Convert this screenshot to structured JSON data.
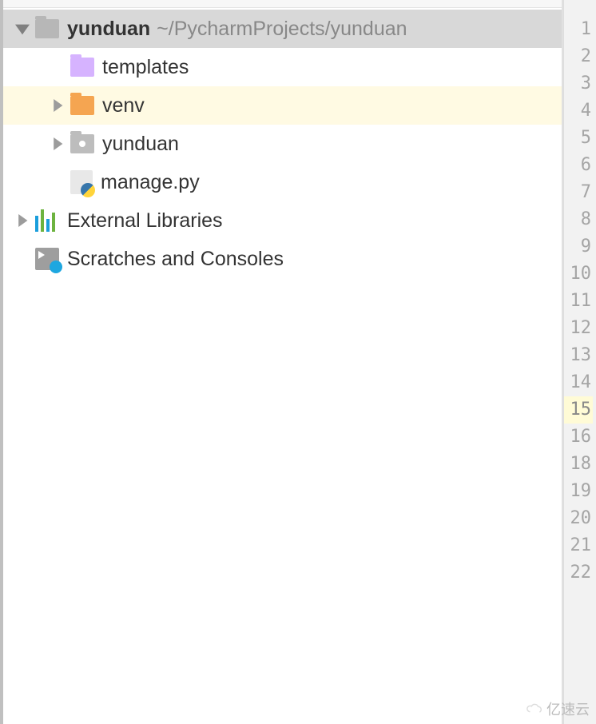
{
  "project": {
    "name": "yunduan",
    "path": "~/PycharmProjects/yunduan",
    "children": [
      {
        "label": "templates",
        "icon": "folder-purple",
        "expandable": false
      },
      {
        "label": "venv",
        "icon": "folder-orange",
        "expandable": true,
        "highlighted": true
      },
      {
        "label": "yunduan",
        "icon": "folder-dot",
        "expandable": true
      },
      {
        "label": "manage.py",
        "icon": "python-file",
        "expandable": false
      }
    ]
  },
  "external_libraries_label": "External Libraries",
  "scratches_label": "Scratches and Consoles",
  "gutter": {
    "lines": [
      1,
      2,
      3,
      4,
      5,
      6,
      7,
      8,
      9,
      10,
      11,
      12,
      13,
      14,
      15,
      16,
      18,
      19,
      20,
      21,
      22
    ],
    "current_line": 15
  },
  "watermark_text": "亿速云"
}
